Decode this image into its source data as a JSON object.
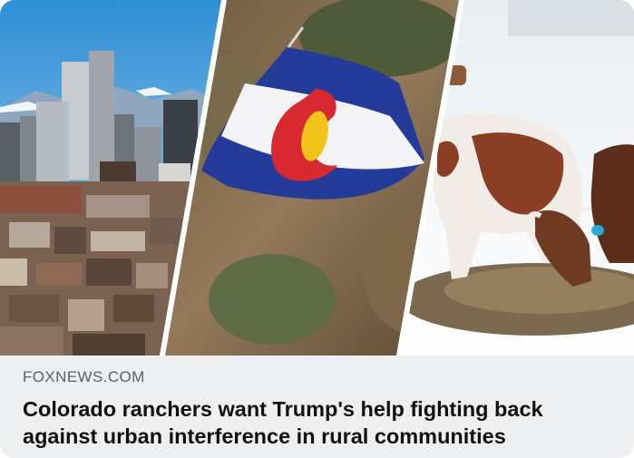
{
  "link_preview": {
    "source": "FOXNEWS.COM",
    "headline": "Colorado ranchers want Trump's help fighting back against urban interference in rural communities"
  },
  "images": [
    {
      "name": "denver-skyline-photo"
    },
    {
      "name": "colorado-flag-photo"
    },
    {
      "name": "cattle-in-snow-photo"
    }
  ],
  "colors": {
    "caption_background": "#eeeff1",
    "source_text": "#5e6063",
    "headline_text": "#111111",
    "flag_blue": "#243b9a",
    "flag_red": "#d82930",
    "flag_gold": "#f2c419"
  }
}
